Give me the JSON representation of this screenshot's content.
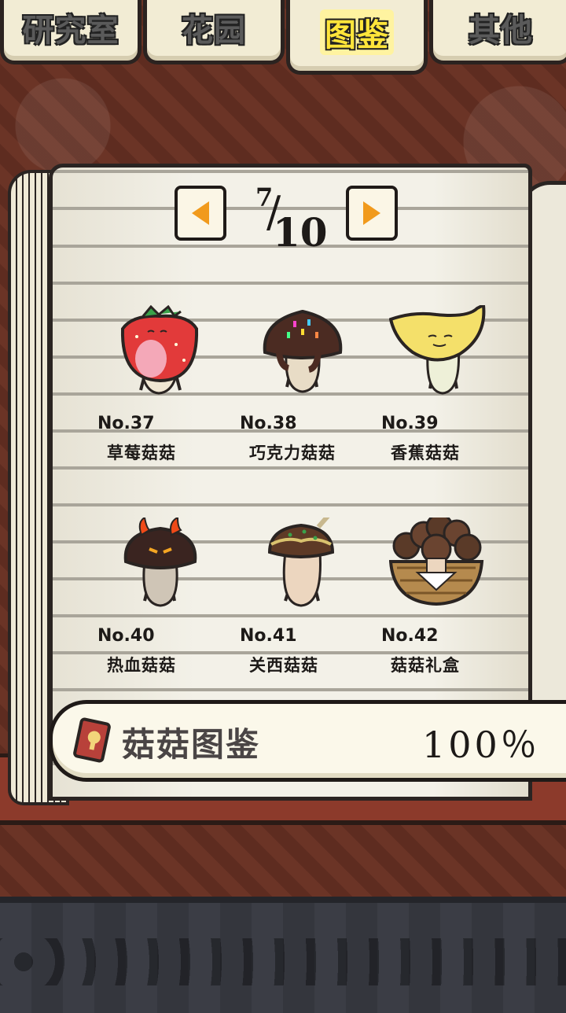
{
  "tabs": [
    {
      "label": "研究室",
      "active": false
    },
    {
      "label": "花园",
      "active": false
    },
    {
      "label": "图鉴",
      "active": true
    },
    {
      "label": "其他",
      "active": false
    }
  ],
  "pager": {
    "current": "7",
    "total": "10",
    "prev_icon": "left-arrow-icon",
    "next_icon": "right-arrow-icon",
    "accent": "#f19a1c"
  },
  "entries": [
    {
      "number": "No.37",
      "name": "草莓菇菇",
      "icon": "strawberry-mushroom-icon"
    },
    {
      "number": "No.38",
      "name": "巧克力菇菇",
      "icon": "chocolate-mushroom-icon"
    },
    {
      "number": "No.39",
      "name": "香蕉菇菇",
      "icon": "banana-mushroom-icon"
    },
    {
      "number": "No.40",
      "name": "热血菇菇",
      "icon": "hot-blooded-mushroom-icon"
    },
    {
      "number": "No.41",
      "name": "关西菇菇",
      "icon": "kansai-mushroom-icon"
    },
    {
      "number": "No.42",
      "name": "菇菇礼盒",
      "icon": "mushroom-gift-box-icon"
    }
  ],
  "collection": {
    "label": "菇菇图鉴",
    "percent": "100％",
    "icon": "book-icon"
  }
}
